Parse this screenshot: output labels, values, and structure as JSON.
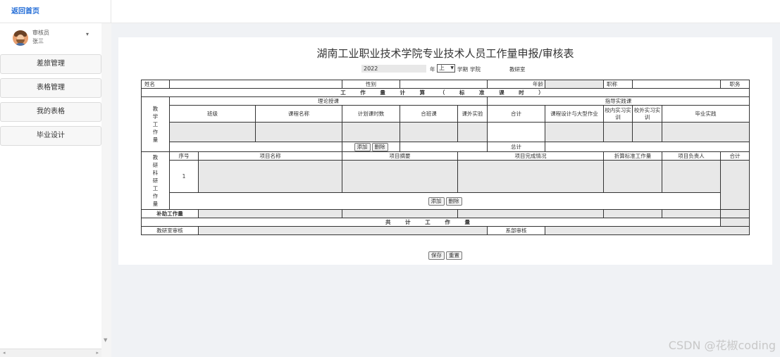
{
  "sidebar": {
    "back_home": "返回首页",
    "user": {
      "role": "审核员",
      "name": "张三"
    },
    "menu": [
      "差旅管理",
      "表格管理",
      "我的表格",
      "毕业设计"
    ]
  },
  "form": {
    "title": "湖南工业职业技术学院专业技术人员工作量申报/审核表",
    "year_value": "2022",
    "year_label": "年",
    "term_value": "上",
    "term_label": "学期",
    "college_label": "学院",
    "office_label": "教研室",
    "personal": {
      "name": "姓名",
      "gender": "性别",
      "age": "年龄",
      "title": "职称",
      "position": "职务"
    },
    "workload_header": "工 作 量 计 算 （ 标 准 课 时 ）",
    "teaching_label": "教学工作量",
    "theory_label": "理论授课",
    "guidance_label": "指导实践课",
    "teaching_cols": [
      "班级",
      "课程名称",
      "计划课时数",
      "合班课",
      "课外实验",
      "合计"
    ],
    "guidance_cols": [
      "课程设计与大型作业",
      "校内实习实训",
      "校外实习实训",
      "毕业实践",
      "合计"
    ],
    "total_label": "总计",
    "research_label": "教研科研工作量",
    "research_cols": [
      "序号",
      "项目名称",
      "项目摘要",
      "项目完成情况",
      "折算标准工作量",
      "项目负责人",
      "合计"
    ],
    "research_row_no": "1",
    "aux_label": "补助工作量",
    "grand_total_label": "共 计 工 作 量",
    "dept_review_label": "教研室审核",
    "faculty_review_label": "系部审核",
    "add_label": "添加",
    "delete_label": "删除",
    "save_label": "保存",
    "reset_label": "重置"
  },
  "watermark": "CSDN @花椒coding"
}
